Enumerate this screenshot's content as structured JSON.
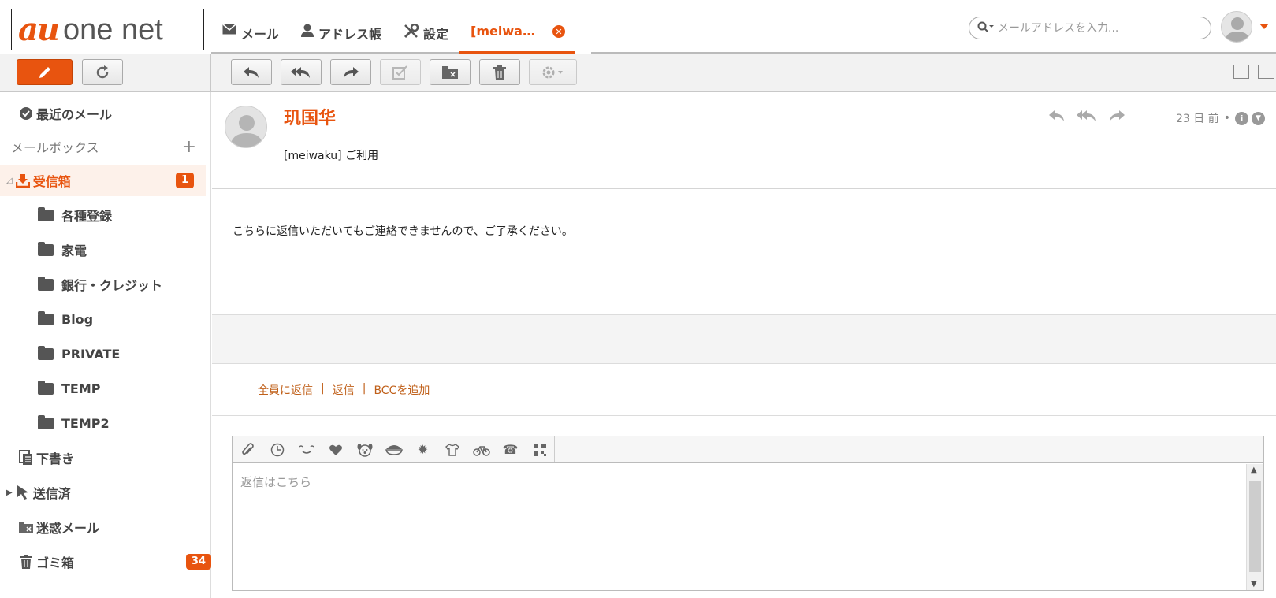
{
  "brand": {
    "logo_au": "au",
    "logo_text": "one net",
    "accent": "#e8540f"
  },
  "nav": {
    "tabs": [
      {
        "label": "メール",
        "icon": "envelope-icon"
      },
      {
        "label": "アドレス帳",
        "icon": "person-icon"
      },
      {
        "label": "設定",
        "icon": "tools-icon"
      },
      {
        "label": "[meiwa…",
        "icon": "close-icon",
        "active": true
      }
    ]
  },
  "search": {
    "placeholder": "メールアドレスを入力..."
  },
  "sidebar": {
    "recent": "最近のメール",
    "mailbox_header": "メールボックス",
    "mailbox_add": "+",
    "inbox": {
      "label": "受信箱",
      "count": "1"
    },
    "folders": [
      "各種登録",
      "家電",
      "銀行・クレジット",
      "Blog",
      "PRIVATE",
      "TEMP",
      "TEMP2"
    ],
    "drafts": "下書き",
    "sent": "送信済",
    "spam": "迷惑メール",
    "trash": {
      "label": "ゴミ箱",
      "count": "34"
    }
  },
  "message": {
    "sender": "玑国华",
    "subject": "[meiwaku] ご利用",
    "time": "23 日 前",
    "dot": "•",
    "body": "こちらに返信いただいてもご連絡できませんので、ご了承ください。"
  },
  "reply": {
    "reply_all": "全員に返信",
    "reply": "返信",
    "add_bcc": "BCCを追加",
    "separator": "|",
    "placeholder": "返信はこちら"
  }
}
